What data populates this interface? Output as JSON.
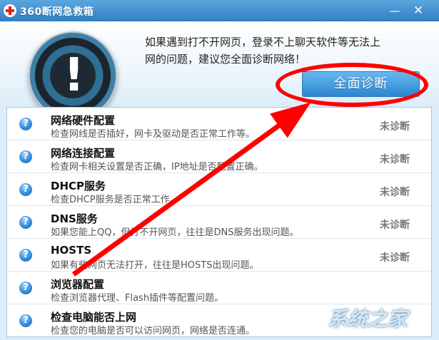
{
  "window": {
    "title": "360断网急救箱",
    "minimize_symbol": "—",
    "close_symbol": "✕"
  },
  "header": {
    "tip_text": "如果遇到打不开网页，登录不上聊天软件等无法上网的问题，建议您全面诊断网络！",
    "diagnose_button_label": "全面诊断",
    "logo_symbol": "!"
  },
  "items": [
    {
      "title": "网络硬件配置",
      "description": "检查网线是否插好，网卡及驱动是否正常工作等。",
      "status": "未诊断"
    },
    {
      "title": "网络连接配置",
      "description": "检查网卡相关设置是否正确，IP地址是否配置正确。",
      "status": "未诊断"
    },
    {
      "title": "DHCP服务",
      "description": "检查DHCP服务是否正常工作。",
      "status": "未诊断"
    },
    {
      "title": "DNS服务",
      "description": "如果您能上QQ，但打不开网页，往往是DNS服务出现问题。",
      "status": "未诊断"
    },
    {
      "title": "HOSTS",
      "description": "如果有些网页无法打开，往往是HOSTS出现问题。",
      "status": "未诊断"
    },
    {
      "title": "浏览器配置",
      "description": "检查浏览器代理、Flash插件等配置问题。",
      "status": ""
    },
    {
      "title": "检查电脑能否上网",
      "description": "检查您的电脑是否可以访问网页，网络是否连通。",
      "status": ""
    }
  ],
  "question_icon_symbol": "?",
  "watermark_text": "系统之家",
  "colors": {
    "annotation_red": "#ff0000",
    "title_blue": "#2f7fc3",
    "button_blue": "#2c86d0"
  }
}
